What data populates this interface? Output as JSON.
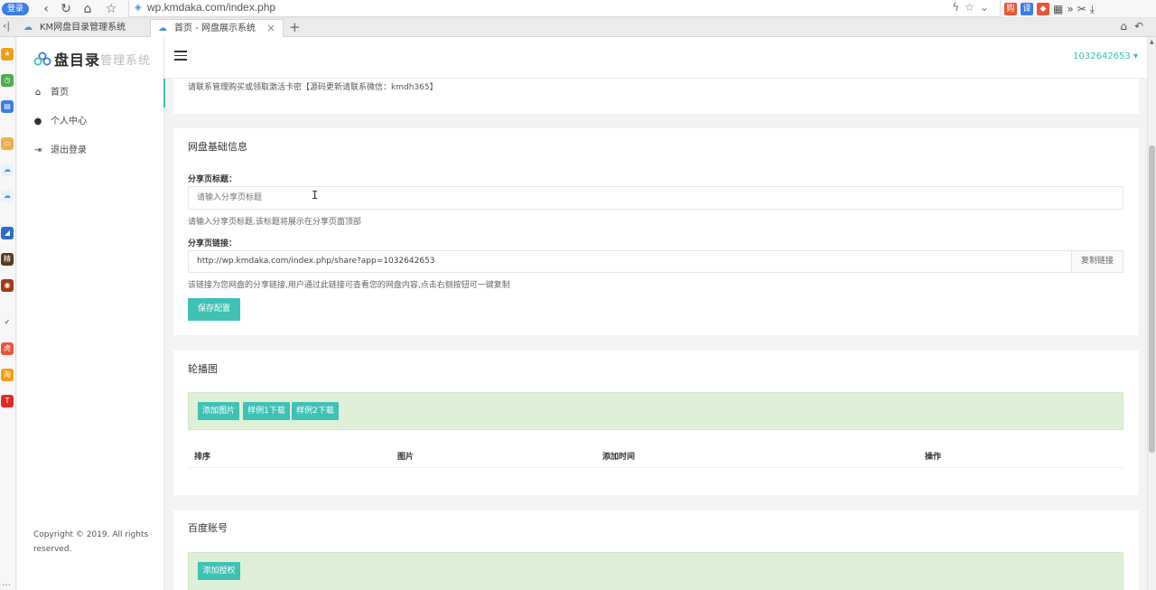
{
  "browser": {
    "login_badge": "登录",
    "url": "wp.kmdaka.com/index.php",
    "tabs": [
      {
        "title": "KM网盘目录管理系统"
      },
      {
        "title": "首页 - 网盘展示系统"
      }
    ],
    "ext_text": "»"
  },
  "sidebar": {
    "logo_main": "盘目录",
    "logo_sub": "管理系统",
    "items": [
      {
        "label": "首页",
        "icon": "home-icon"
      },
      {
        "label": "个人中心",
        "icon": "user-icon"
      },
      {
        "label": "退出登录",
        "icon": "logout-icon"
      }
    ],
    "copyright": "Copyright © 2019. All rights reserved."
  },
  "header": {
    "user": "1032642653"
  },
  "notice": {
    "text": "请联系管理购买或领取激活卡密【源码更新请联系微信：kmdh365】"
  },
  "disk_info": {
    "title": "网盘基础信息",
    "share_title_label": "分享页标题：",
    "share_title_placeholder": "请输入分享页标题",
    "share_title_help": "请输入分享页标题,该标题将展示在分享页面顶部",
    "share_link_label": "分享页链接：",
    "share_link_value": "http://wp.kmdaka.com/index.php/share?app=1032642653",
    "copy_label": "复制链接",
    "share_link_help": "该链接为您网盘的分享链接,用户通过此链接可查看您的网盘内容,点击右侧按钮可一键复制",
    "save_label": "保存配置"
  },
  "carousel": {
    "title": "轮播图",
    "buttons": [
      "添加图片",
      "样例1下载",
      "样例2下载"
    ],
    "columns": [
      "排序",
      "图片",
      "添加时间",
      "操作"
    ]
  },
  "baidu": {
    "title": "百度账号",
    "add_auth_label": "添加授权"
  },
  "colors": {
    "accent": "#3fc1b4",
    "alert_bg": "#dff0d8",
    "browser_blue": "#3b7de8"
  }
}
